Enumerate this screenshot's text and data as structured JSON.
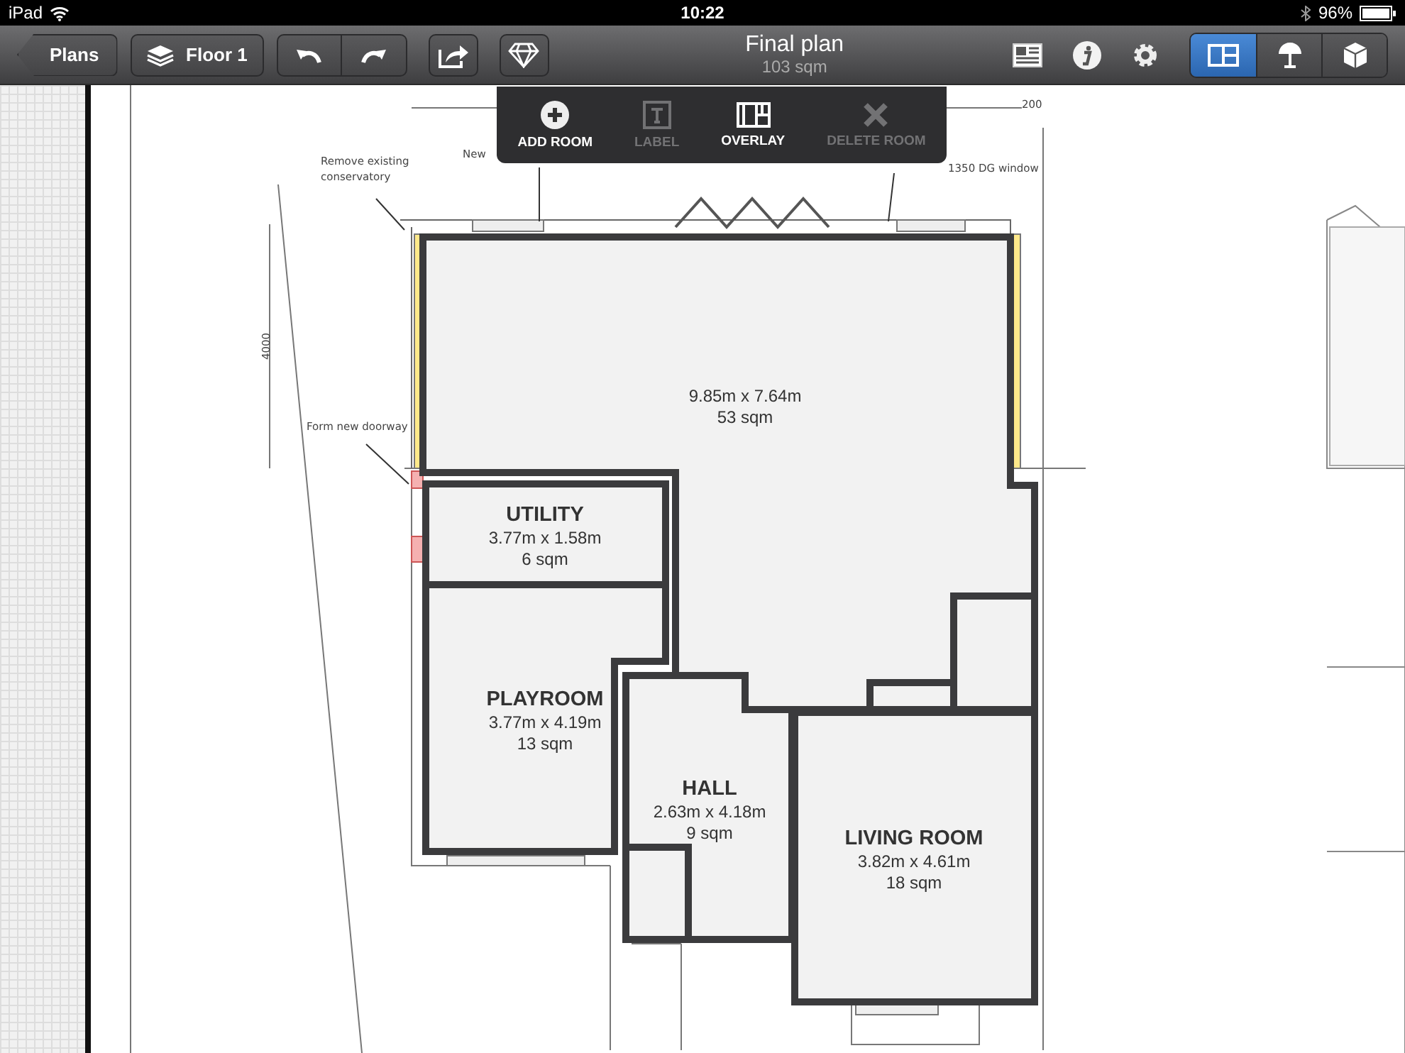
{
  "status_bar": {
    "device": "iPad",
    "time": "10:22",
    "battery": "96%"
  },
  "toolbar": {
    "back_button": "Plans",
    "floor_button": "Floor 1",
    "title": "Final plan",
    "subtitle": "103 sqm",
    "view_modes": [
      {
        "selected": true
      },
      {
        "selected": false
      },
      {
        "selected": false
      }
    ]
  },
  "popover_menu": [
    {
      "kind": "add",
      "label": "ADD ROOM",
      "disabled": false
    },
    {
      "kind": "label",
      "label": "LABEL",
      "disabled": true
    },
    {
      "kind": "overlay",
      "label": "OVERLAY",
      "disabled": false
    },
    {
      "kind": "delete",
      "label": "DELETE ROOM",
      "disabled": true
    }
  ],
  "plan": {
    "rooms": [
      {
        "dimensions": "9.85m x 7.64m",
        "area": "53 sqm"
      },
      {
        "name": "UTILITY",
        "dimensions": "3.77m x 1.58m",
        "area": "6 sqm"
      },
      {
        "name": "PLAYROOM",
        "dimensions": "3.77m x 4.19m",
        "area": "13 sqm"
      },
      {
        "name": "HALL",
        "dimensions": "2.63m x 4.18m",
        "area": "9 sqm"
      },
      {
        "name": "LIVING ROOM",
        "dimensions": "3.82m x 4.61m",
        "area": "18 sqm"
      }
    ],
    "annotations": [
      "Remove existing",
      "conservatory",
      "New",
      "1350 DG window",
      "Form new doorway",
      "4000",
      "200"
    ]
  }
}
